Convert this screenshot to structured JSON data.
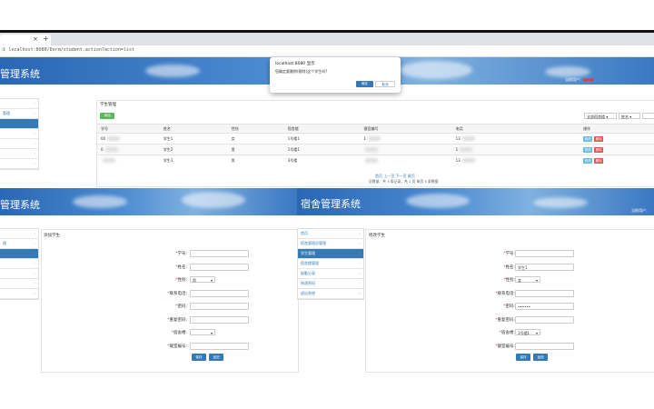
{
  "browser": {
    "tab_close": "×",
    "tab_new": "+",
    "url": "① localhost:8080/Dorm/student.action?action=list"
  },
  "app": {
    "title_left": "管理系统",
    "title_bottom_left": "管理系统",
    "title_bottom_right": "宿舍管理系统",
    "current_user_label": "当前用户：",
    "current_user_label_short": "当前用户："
  },
  "sidebar": {
    "top_items": [
      {
        "label": ""
      },
      {
        "label": "管理"
      },
      {
        "label": "",
        "active": true
      },
      {
        "label": ""
      },
      {
        "label": ""
      },
      {
        "label": ""
      },
      {
        "label": ""
      }
    ],
    "bl_items": [
      {
        "label": ""
      },
      {
        "label": "理"
      },
      {
        "label": "",
        "active": true
      },
      {
        "label": ""
      },
      {
        "label": ""
      },
      {
        "label": ""
      },
      {
        "label": ""
      }
    ],
    "br_items": [
      {
        "label": "首页"
      },
      {
        "label": "宿舍管理员管理"
      },
      {
        "label": "学生管理",
        "active": true
      },
      {
        "label": "宿舍楼管理"
      },
      {
        "label": "缺勤记录"
      },
      {
        "label": "修改密码"
      },
      {
        "label": "退出系统"
      }
    ],
    "chevron": "›"
  },
  "list_panel": {
    "title": "学生管理",
    "add_button": "添加",
    "filter_select": "全部宿舍楼",
    "filter_field": "姓名",
    "columns": [
      "学号",
      "姓名",
      "性别",
      "宿舍楼",
      "寝室编号",
      "电话",
      "操作"
    ],
    "rows": [
      {
        "id": "00",
        "name": "学生1",
        "sex": "女",
        "build": "1号楼1",
        "room": "1",
        "tel": "13"
      },
      {
        "id": "0",
        "name": "学生2",
        "sex": "男",
        "build": "1号楼1",
        "room": "",
        "tel": "1"
      },
      {
        "id": "",
        "name": "学生3",
        "sex": "男",
        "build": "3号楼",
        "room": "",
        "tel": "13"
      }
    ],
    "edit_label": "修改",
    "delete_label": "删除",
    "pager_links": "首页 上一页 下一页 尾页",
    "pager_info": "总数量：共 3 条记录，共 1 页 每页 5 条数据"
  },
  "dialog": {
    "title": "localhost:8080 显示",
    "message": "您确定要删除(剔除)这个学生吗?",
    "ok": "确定",
    "cancel": "取消"
  },
  "add_form": {
    "title": "添加学生",
    "fields": [
      {
        "label": "学号:",
        "value": ""
      },
      {
        "label": "姓名:",
        "value": ""
      },
      {
        "label": "性别:",
        "value": "男"
      },
      {
        "label": "联系电话:",
        "value": ""
      },
      {
        "label": "密码:",
        "value": ""
      },
      {
        "label": "重复密码:",
        "value": ""
      },
      {
        "label": "宿舍楼:",
        "value": ""
      },
      {
        "label": "寝室编号:",
        "value": ""
      }
    ],
    "save": "保存",
    "back": "返回"
  },
  "edit_form": {
    "title": "修改学生",
    "fields": [
      {
        "label": "学号:",
        "value": ""
      },
      {
        "label": "姓名:",
        "value": "学生1"
      },
      {
        "label": "性别:",
        "value": "女"
      },
      {
        "label": "联系电话:",
        "value": ""
      },
      {
        "label": "密码:",
        "value": "••••••"
      },
      {
        "label": "重复密码:",
        "value": ""
      },
      {
        "label": "宿舍楼:",
        "value": "1号楼1"
      },
      {
        "label": "寝室编号:",
        "value": ""
      }
    ],
    "save": "保存",
    "back": "返回"
  }
}
